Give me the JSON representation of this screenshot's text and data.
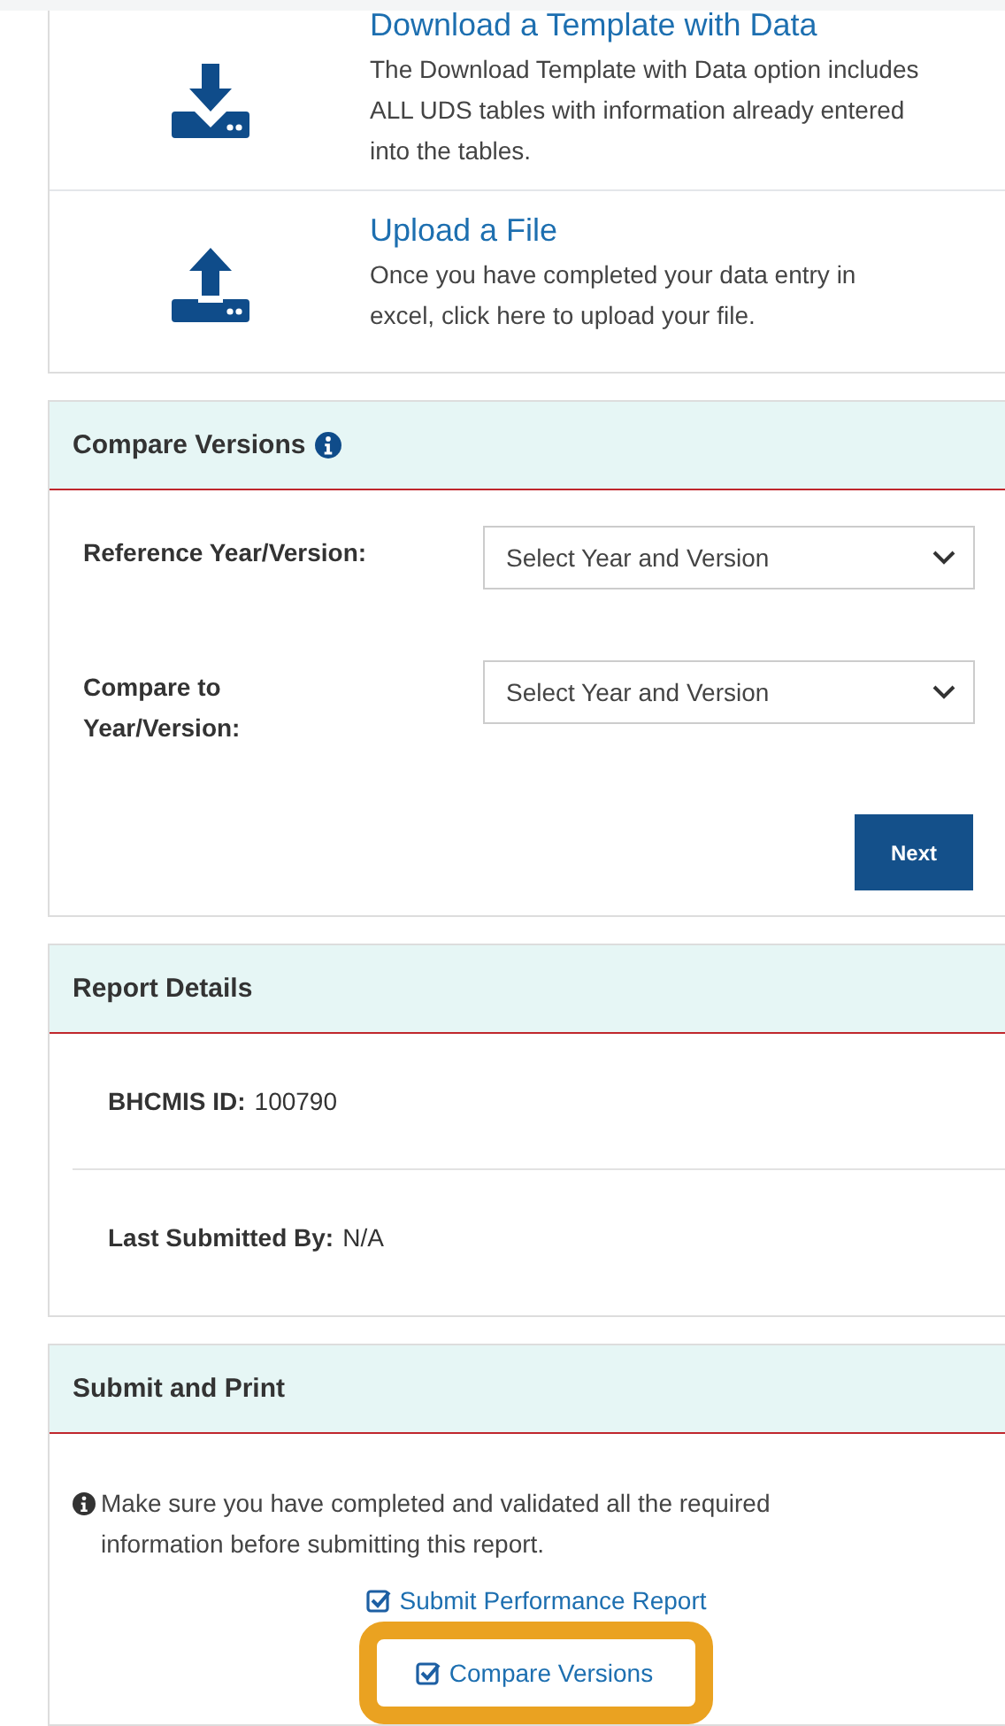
{
  "options": [
    {
      "kind": "download",
      "title": "Download a Template with Data",
      "description": "The Download Template with Data option includes ALL UDS tables with information already entered into the tables."
    },
    {
      "kind": "upload",
      "title": "Upload a File",
      "description": "Once you have completed your data entry in excel, click here to upload your file."
    }
  ],
  "compare_panel": {
    "title": "Compare Versions",
    "fields": [
      {
        "label": "Reference Year/Version:",
        "value": "Select Year and Version"
      },
      {
        "label": "Compare to Year/Version:",
        "value": "Select Year and Version"
      }
    ],
    "next_button": "Next"
  },
  "report_details": {
    "title": "Report Details",
    "rows": [
      {
        "label": "BHCMIS ID:",
        "value": "100790"
      },
      {
        "label": "Last Submitted By:",
        "value": "N/A"
      }
    ]
  },
  "submit_panel": {
    "title": "Submit and Print",
    "notice": "Make sure you have completed and validated all the required information before submitting this report.",
    "links": [
      {
        "label": "Submit Performance Report",
        "highlighted": false
      },
      {
        "label": "Compare Versions",
        "highlighted": true
      }
    ]
  }
}
